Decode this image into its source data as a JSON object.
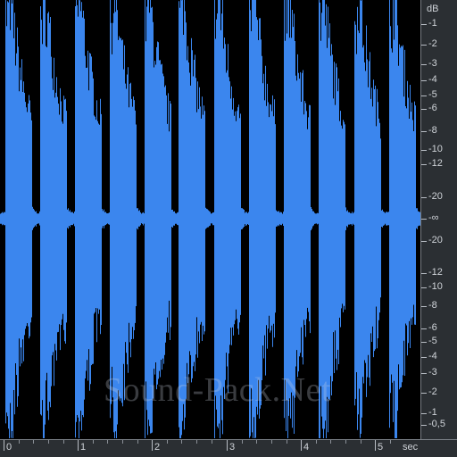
{
  "colors": {
    "waveform": "#3b86ee",
    "background": "#000000",
    "ruler": "#2b2f33"
  },
  "db_ruler": {
    "unit": "dB",
    "upper": [
      "-1",
      "-2",
      "-3",
      "-4",
      "-5",
      "-6",
      "-8",
      "-10",
      "-12",
      "-20"
    ],
    "center": "-∞",
    "lower": [
      "-20",
      "-12",
      "-10",
      "-8",
      "-6",
      "-5",
      "-4",
      "-3",
      "-2",
      "-1",
      "-0,5"
    ],
    "upper_levels": [
      0.891,
      0.794,
      0.708,
      0.631,
      0.562,
      0.501,
      0.398,
      0.316,
      0.251,
      0.1
    ],
    "lower_levels": [
      0.1,
      0.251,
      0.316,
      0.398,
      0.501,
      0.562,
      0.631,
      0.708,
      0.794,
      0.891,
      0.944
    ]
  },
  "time_ruler": {
    "unit": "sec",
    "labels": [
      "0",
      "1",
      "2",
      "3",
      "4",
      "5"
    ],
    "seconds": [
      0,
      1,
      2,
      3,
      4,
      5
    ]
  },
  "watermark": "Sound-Pack.Net"
}
